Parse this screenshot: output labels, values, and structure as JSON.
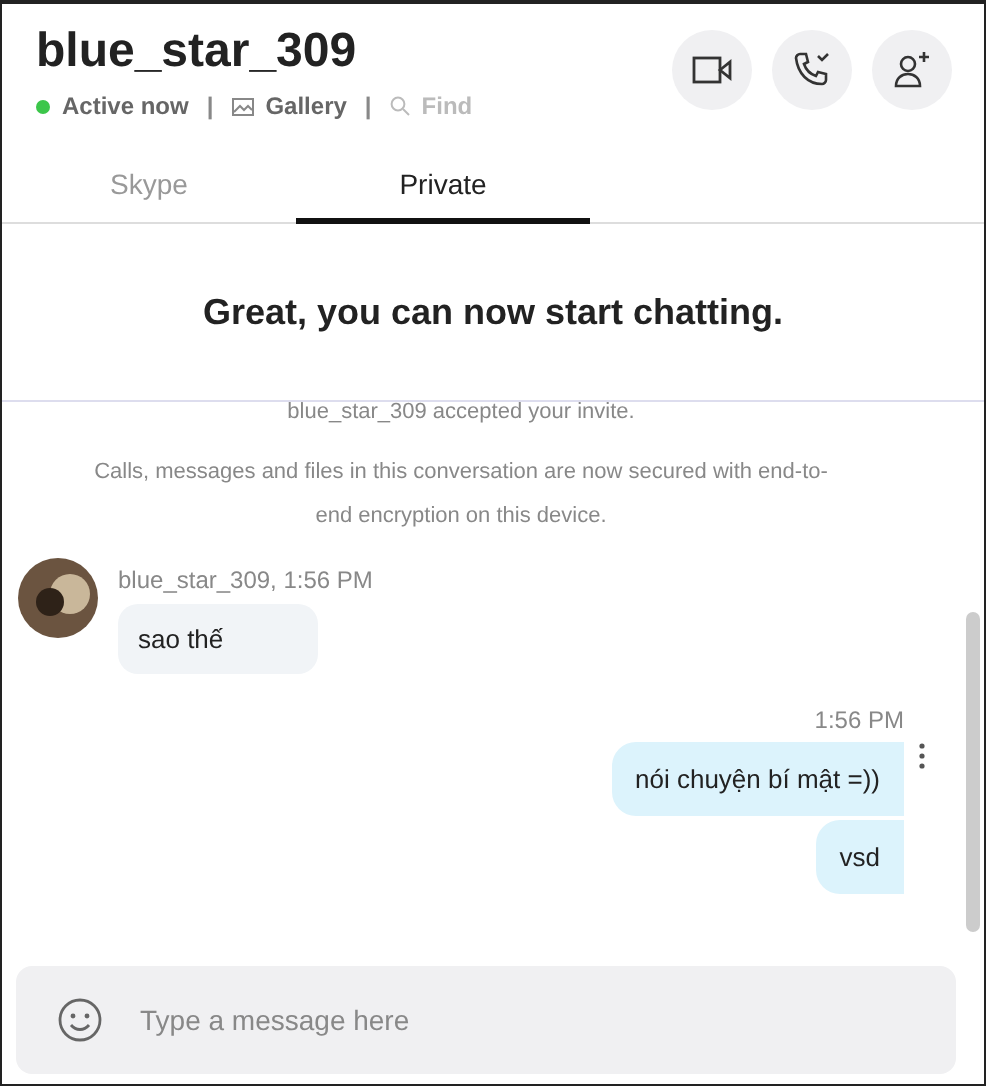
{
  "header": {
    "title": "blue_star_309",
    "status": "Active now",
    "gallery": "Gallery",
    "find": "Find",
    "online": true,
    "separators": [
      "|",
      "|"
    ]
  },
  "tabs": [
    {
      "label": "Skype",
      "selected": false
    },
    {
      "label": "Private",
      "selected": true
    }
  ],
  "banner": "Great, you can now start chatting.",
  "notices": [
    "blue_star_309 accepted your invite.",
    "Calls, messages and files in this conversation are now secured with end-to-end encryption on this device."
  ],
  "incoming": {
    "meta": "blue_star_309, 1:56 PM",
    "messages": [
      "sao thế"
    ]
  },
  "outgoing": {
    "time": "1:56 PM",
    "messages": [
      "nói chuyện bí mật =))",
      "vsd"
    ]
  },
  "composer": {
    "placeholder": "Type a message here"
  }
}
